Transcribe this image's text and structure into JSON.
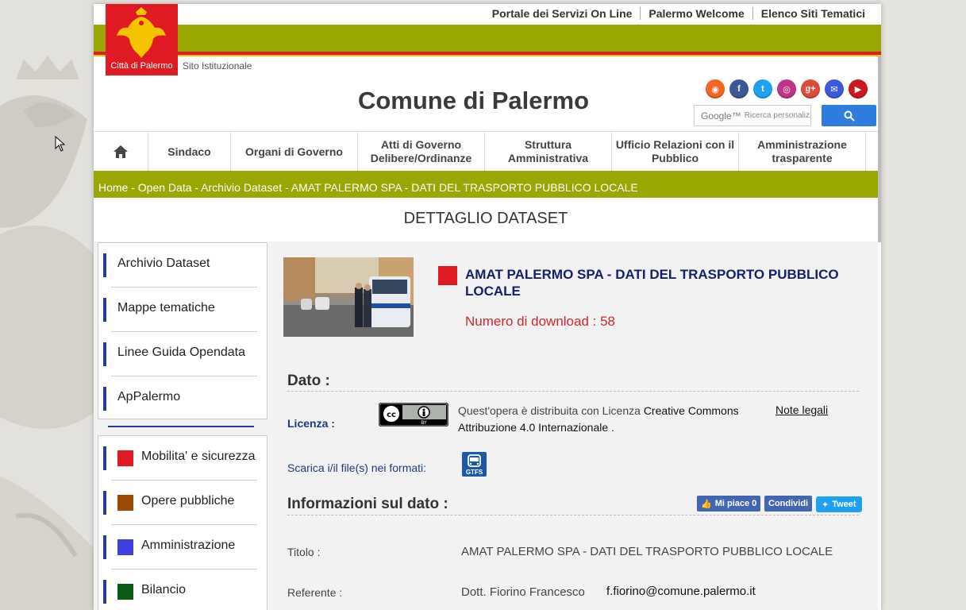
{
  "header": {
    "top_links": [
      "Portale dei Servizi On Line",
      "Palermo Welcome",
      "Elenco Siti Tematici"
    ],
    "logo_text": "Città di Palermo",
    "sito_label": "Sito Istituzionale",
    "site_title": "Comune di Palermo",
    "search_placeholder": "Ricerca personalizzata",
    "search_brand": "Google™",
    "socials": [
      {
        "icon": "rss-icon",
        "glyph": "◉",
        "color": "#f26522"
      },
      {
        "icon": "facebook-icon",
        "glyph": "f",
        "color": "#3b5998"
      },
      {
        "icon": "twitter-icon",
        "glyph": "t",
        "color": "#1da1f2"
      },
      {
        "icon": "instagram-icon",
        "glyph": "◎",
        "color": "#c13584"
      },
      {
        "icon": "google-plus-icon",
        "glyph": "g+",
        "color": "#dd4b39"
      },
      {
        "icon": "email-icon",
        "glyph": "✉",
        "color": "#3b5bdb"
      },
      {
        "icon": "youtube-icon",
        "glyph": "▶",
        "color": "#cc181e"
      }
    ]
  },
  "nav": [
    {
      "label": "",
      "icon": "home-icon"
    },
    {
      "label": "Sindaco"
    },
    {
      "label": "Organi di Governo"
    },
    {
      "label": "Atti di Governo Delibere/Ordinanze"
    },
    {
      "label": "Struttura Amministrativa"
    },
    {
      "label": "Ufficio Relazioni con il Pubblico"
    },
    {
      "label": "Amministrazione trasparente"
    }
  ],
  "breadcrumb": "Home - Open Data - Archivio Dataset - AMAT PALERMO SPA - DATI DEL TRASPORTO PUBBLICO LOCALE",
  "section_title": "DETTAGLIO DATASET",
  "sidebar": {
    "links": [
      "Archivio Dataset",
      "Mappe tematiche",
      "Linee Guida Opendata",
      "ApPalermo"
    ],
    "categories": [
      {
        "label": "Mobilita' e sicurezza",
        "color": "#e01a22"
      },
      {
        "label": "Opere pubbliche",
        "color": "#9b4a05"
      },
      {
        "label": "Amministrazione",
        "color": "#4040e0"
      },
      {
        "label": "Bilancio",
        "color": "#0c5a12"
      }
    ]
  },
  "dataset": {
    "title": "AMAT PALERMO SPA - DATI DEL TRASPORTO PUBBLICO LOCALE",
    "downloads": "Numero di download : 58",
    "dato_heading": "Dato :",
    "licenza_label": "Licenza :",
    "cc_badge": "cc BY",
    "licenza_prefix": "Quest'opera è distribuita con Licenza ",
    "licenza_name": "Creative Commons Attribuzione 4.0 Internazionale",
    "licenza_suffix": " .",
    "note_legali": "Note legali",
    "scarica_label": "Scarica i/il file(s) nei formati:",
    "format": "GTFS",
    "info_heading": "Informazioni sul dato :",
    "social": {
      "like": "Mi piace 0",
      "share": "Condividi",
      "tweet": "Tweet"
    },
    "rows": [
      {
        "label": "Titolo :",
        "value": "AMAT PALERMO SPA - DATI DEL TRASPORTO PUBBLICO LOCALE",
        "extra": ""
      },
      {
        "label": "Referente :",
        "value": "Dott. Fiorino Francesco",
        "extra": "f.fiorino@comune.palermo.it"
      }
    ]
  }
}
